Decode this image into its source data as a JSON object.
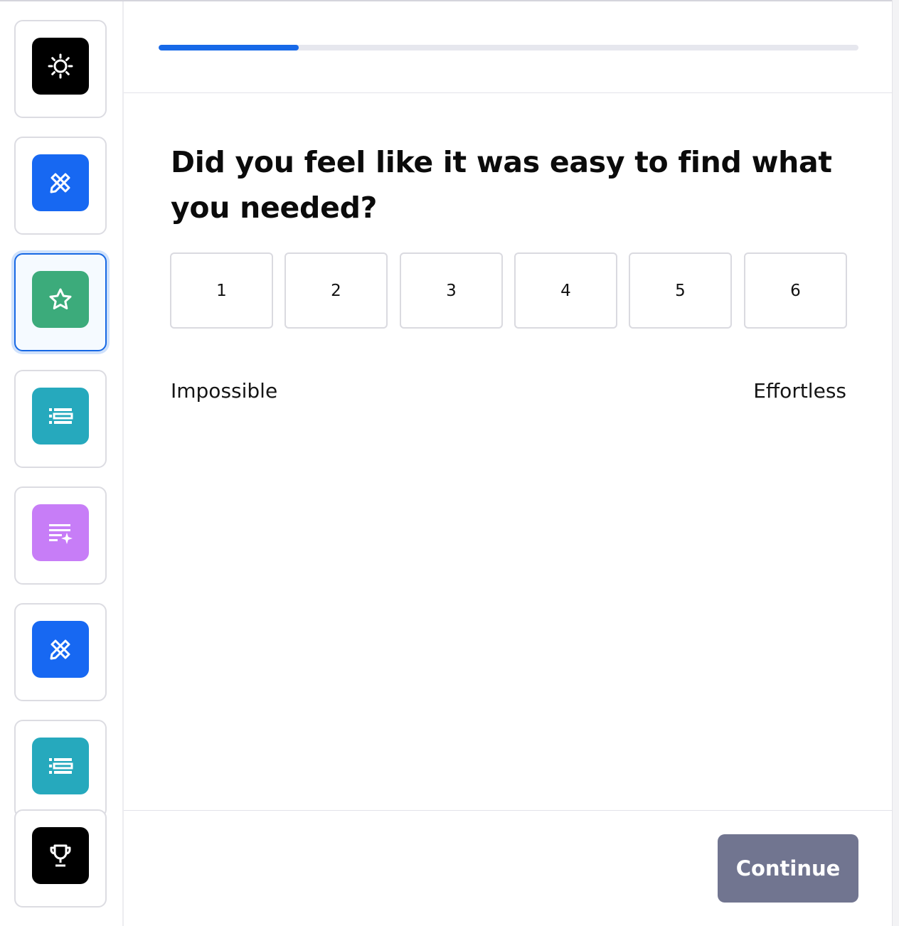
{
  "progress": {
    "fraction": 0.2
  },
  "sidebar": {
    "steps": [
      {
        "icon": "settings-gear-icon",
        "color": "#000000",
        "active": false
      },
      {
        "icon": "pencil-ruler-icon",
        "color": "#1768f2",
        "active": false
      },
      {
        "icon": "star-icon",
        "color": "#3cab7b",
        "active": true
      },
      {
        "icon": "list-icon",
        "color": "#26a9bd",
        "active": false
      },
      {
        "icon": "text-sparkle-icon",
        "color": "#c77df7",
        "active": false
      },
      {
        "icon": "pencil-ruler-icon",
        "color": "#1768f2",
        "active": false
      },
      {
        "icon": "list-icon",
        "color": "#26a9bd",
        "active": false
      },
      {
        "icon": "trophy-icon",
        "color": "#000000",
        "active": false
      }
    ]
  },
  "question": {
    "text": "Did you feel like it was easy to find what you needed?",
    "options": [
      "1",
      "2",
      "3",
      "4",
      "5",
      "6"
    ],
    "label_low": "Impossible",
    "label_high": "Effortless"
  },
  "footer": {
    "continue_label": "Continue"
  }
}
